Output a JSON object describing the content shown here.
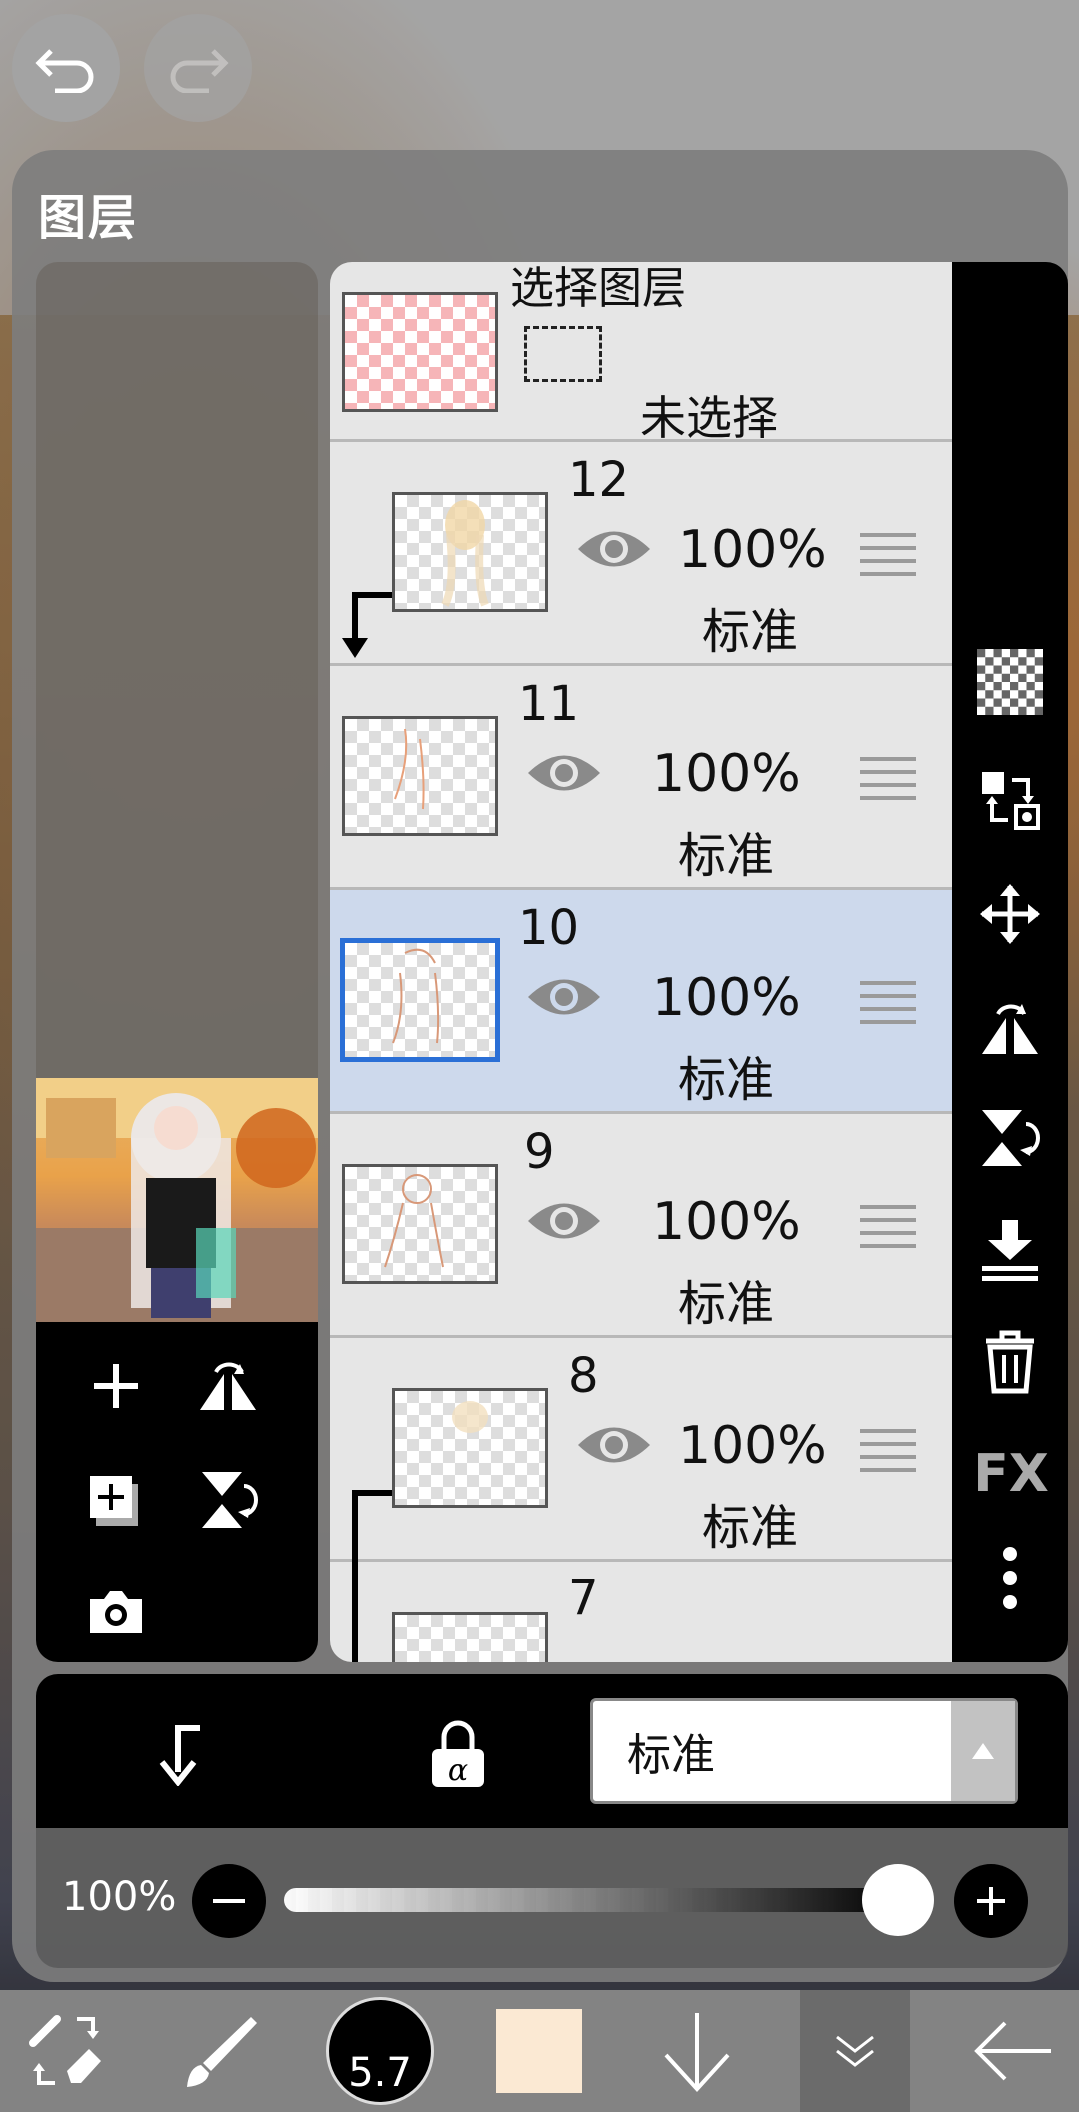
{
  "panel": {
    "title": "图层"
  },
  "select_layer": {
    "title": "选择图层",
    "status": "未选择"
  },
  "layers": [
    {
      "number": "12",
      "opacity": "100%",
      "mode": "标准",
      "visible": true,
      "clipped": true,
      "selected": false
    },
    {
      "number": "11",
      "opacity": "100%",
      "mode": "标准",
      "visible": true,
      "clipped": false,
      "selected": false
    },
    {
      "number": "10",
      "opacity": "100%",
      "mode": "标准",
      "visible": true,
      "clipped": false,
      "selected": true
    },
    {
      "number": "9",
      "opacity": "100%",
      "mode": "标准",
      "visible": true,
      "clipped": false,
      "selected": false
    },
    {
      "number": "8",
      "opacity": "100%",
      "mode": "标准",
      "visible": true,
      "clipped": true,
      "selected": false
    },
    {
      "number": "7"
    }
  ],
  "right_tools": [
    "transparent-icon",
    "swap-layer-icon",
    "move-icon",
    "flip-horizontal-icon",
    "flip-vertical-icon",
    "merge-down-icon",
    "trash-icon",
    "fx-icon",
    "more-icon"
  ],
  "fx_label": "FX",
  "blend": {
    "mode": "标准"
  },
  "opacity": {
    "label": "100%",
    "value": 1.0
  },
  "brush": {
    "size": "5.7"
  },
  "colors": {
    "current": "#fbe9d3",
    "selected_border": "#2a6fd6",
    "selected_row": "#cdd9ec"
  }
}
